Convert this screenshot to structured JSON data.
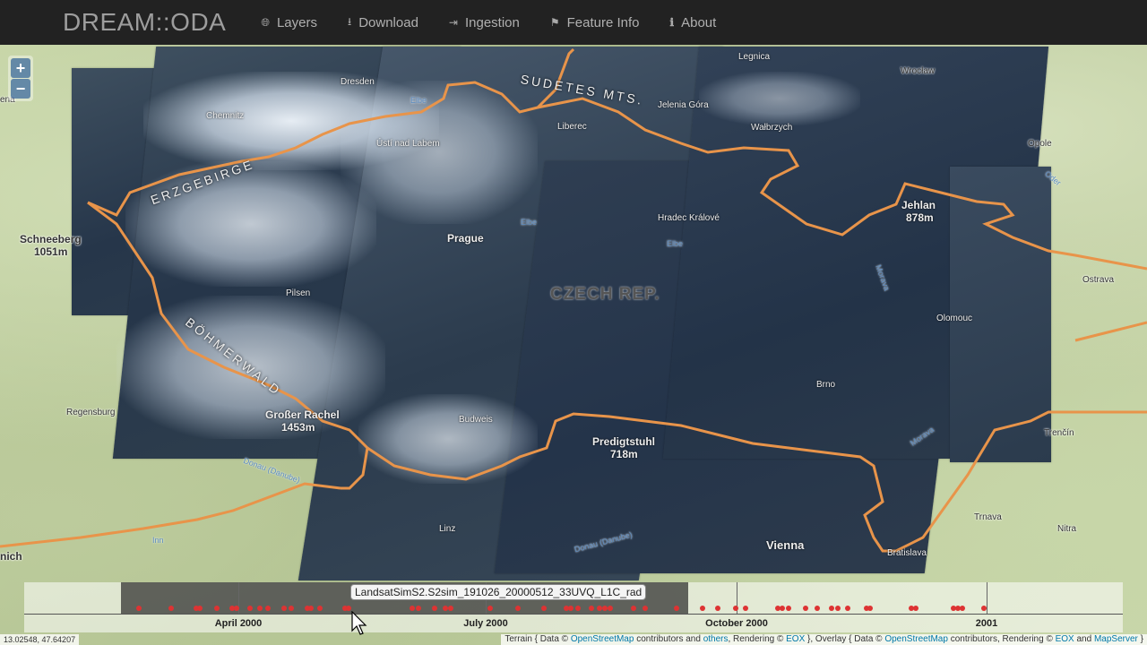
{
  "app": {
    "title": "DREAM::ODA"
  },
  "nav": [
    {
      "label": "Layers",
      "icon": "globe-icon"
    },
    {
      "label": "Download",
      "icon": "download-icon"
    },
    {
      "label": "Ingestion",
      "icon": "sign-in-icon"
    },
    {
      "label": "Feature Info",
      "icon": "map-marker-icon"
    },
    {
      "label": "About",
      "icon": "info-icon"
    }
  ],
  "zoom": {
    "in_label": "+",
    "out_label": "−"
  },
  "map_labels": {
    "chemnitz": "Chemnitz",
    "dresden": "Dresden",
    "usti": "Ústí nad Labem",
    "liberec": "Liberec",
    "jelenia": "Jelenia Góra",
    "walbrzych": "Wałbrzych",
    "legnica": "Legnica",
    "wroclaw": "Wrocław",
    "opole": "Opole",
    "sudetes": "SUDETES MTS.",
    "erzgebirge": "ERZGEBIRGE",
    "boehmerwald": "BÖHMERWALD",
    "schneeberg": "Schneeberg",
    "schneeberg_alt": "1051m",
    "prague": "Prague",
    "hradec": "Hradec Králové",
    "jehlan": "Jehlan",
    "jehlan_alt": "878m",
    "pilsen": "Pilsen",
    "czech": "CZECH REP.",
    "olomouc": "Olomouc",
    "ostrava": "Ostrava",
    "brno": "Brno",
    "regensburg": "Regensburg",
    "rachel": "Großer Rachel",
    "rachel_alt": "1453m",
    "budweis": "Budweis",
    "predigtstuhl": "Predigtstuhl",
    "predigtstuhl_alt": "718m",
    "linz": "Linz",
    "vienna": "Vienna",
    "bratislava": "Bratislava",
    "trnava": "Trnava",
    "nitra": "Nitra",
    "trencin": "Trenčín",
    "munich": "nich",
    "jena": "ena"
  },
  "rivers": {
    "elbe1": "Elbe",
    "elbe2": "Elbe",
    "elbe3": "Elbe",
    "morava": "Morava",
    "donau1": "Donau (Danube)",
    "donau2": "Donau (Danube)",
    "morava2": "Morava",
    "oder": "Oder",
    "inn": "Inn"
  },
  "timeline": {
    "tooltip": "LandsatSimS2.S2sim_191026_20000512_33UVQ_L1C_rad",
    "ticks": [
      {
        "label": "April 2000"
      },
      {
        "label": "July 2000"
      },
      {
        "label": "October 2000"
      },
      {
        "label": "2001"
      }
    ]
  },
  "status": {
    "coords": "13.02548, 47.64207"
  },
  "attribution": {
    "p1": "Terrain { Data © ",
    "l1": "OpenStreetMap",
    "p2": " contributors and ",
    "l2": "others",
    "p3": ", Rendering © ",
    "l3": "EOX",
    "p4": " }, Overlay { Data © ",
    "l4": "OpenStreetMap",
    "p5": " contributors, Rendering © ",
    "l5": "EOX",
    "p6": " and ",
    "l6": "MapServer",
    "p7": " }"
  },
  "colors": {
    "navbar": "#222222",
    "border_line": "#e8944a",
    "timeline_dot": "#dd3333"
  }
}
